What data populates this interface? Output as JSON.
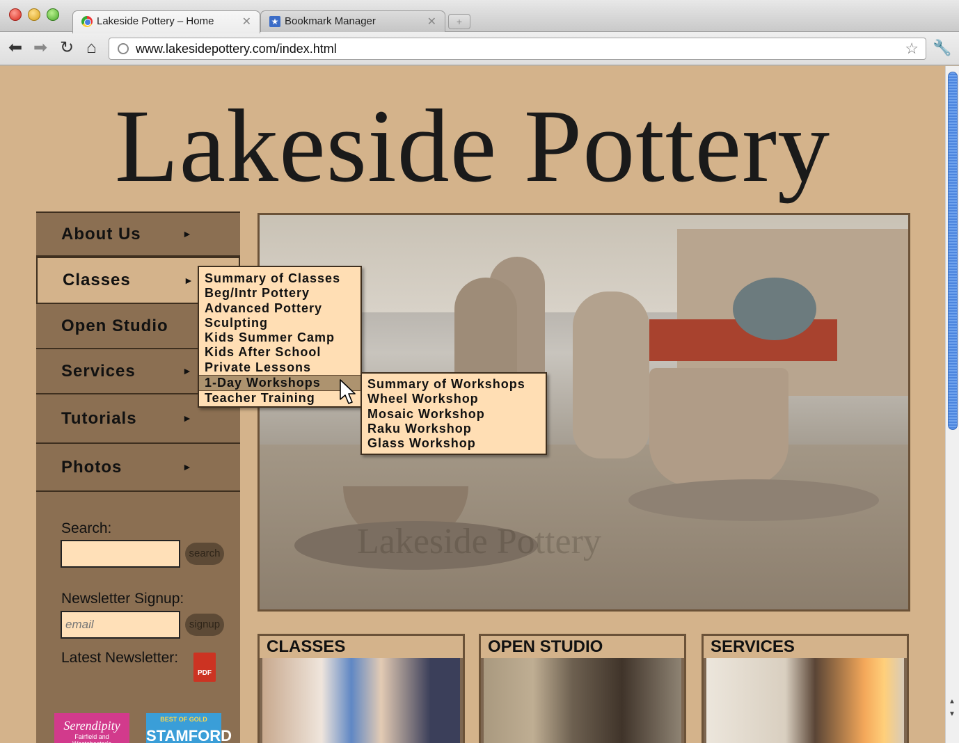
{
  "browser": {
    "tabs": [
      {
        "title": "Lakeside Pottery – Home",
        "active": true
      },
      {
        "title": "Bookmark Manager",
        "active": false
      }
    ],
    "url": "www.lakesidepottery.com/index.html"
  },
  "site": {
    "logo": "Lakeside Pottery",
    "nav": [
      {
        "label": "About Us",
        "has_submenu": true
      },
      {
        "label": "Classes",
        "has_submenu": true,
        "active": true
      },
      {
        "label": "Open Studio",
        "has_submenu": false
      },
      {
        "label": "Services",
        "has_submenu": true
      },
      {
        "label": "Tutorials",
        "has_submenu": true
      },
      {
        "label": "Photos",
        "has_submenu": true
      }
    ],
    "classes_menu": [
      "Summary of Classes",
      "Beg/Intr Pottery",
      "Advanced Pottery",
      "Sculpting",
      "Kids Summer Camp",
      "Kids After School",
      "Private Lessons",
      "1-Day Workshops",
      "Teacher Training"
    ],
    "workshops_menu": [
      "Summary of Workshops",
      "Wheel Workshop",
      "Mosaic Workshop",
      "Raku Workshop",
      "Glass Workshop"
    ],
    "search": {
      "label": "Search:",
      "value": "",
      "button": "search"
    },
    "newsletter": {
      "label": "Newsletter Signup:",
      "placeholder": "email",
      "button": "signup"
    },
    "latest_newsletter": {
      "label": "Latest Newsletter:",
      "icon_text": "PDF"
    },
    "badges": [
      {
        "title": "Serendipity",
        "subtitle": "Fairfield and Westchester's"
      },
      {
        "title": "STAMFORD",
        "subtitle": "BEST OF GOLD"
      }
    ],
    "hero_watermark": "Lakeside Pottery",
    "features": [
      "CLASSES",
      "OPEN STUDIO",
      "SERVICES"
    ]
  },
  "colors": {
    "page_bg": "#d4b38b",
    "sidebar_bg": "#8b6f52",
    "menu_bg": "#ffdeb4",
    "hover_bg": "#ad936f"
  }
}
